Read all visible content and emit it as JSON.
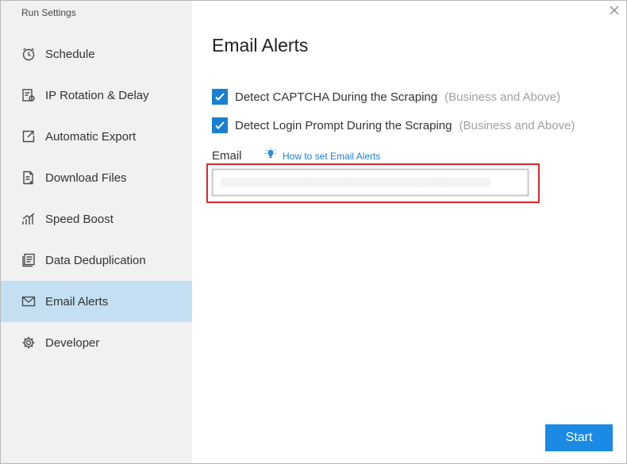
{
  "window": {
    "title": "Run Settings"
  },
  "sidebar": {
    "items": [
      {
        "label": "Schedule",
        "icon": "clock-icon",
        "active": false
      },
      {
        "label": "IP Rotation & Delay",
        "icon": "ip-rotation-icon",
        "active": false
      },
      {
        "label": "Automatic Export",
        "icon": "export-icon",
        "active": false
      },
      {
        "label": "Download Files",
        "icon": "file-download-icon",
        "active": false
      },
      {
        "label": "Speed Boost",
        "icon": "speed-boost-icon",
        "active": false
      },
      {
        "label": "Data Deduplication",
        "icon": "deduplication-icon",
        "active": false
      },
      {
        "label": "Email Alerts",
        "icon": "envelope-icon",
        "active": true
      },
      {
        "label": "Developer",
        "icon": "gear-icon",
        "active": false
      }
    ]
  },
  "main": {
    "title": "Email Alerts",
    "options": [
      {
        "label": "Detect CAPTCHA During the Scraping",
        "tier": "(Business and Above)",
        "checked": true
      },
      {
        "label": "Detect Login Prompt During the Scraping",
        "tier": "(Business and Above)",
        "checked": true
      }
    ],
    "email": {
      "label": "Email",
      "help_link": "How to set Email Alerts",
      "value": "░░░░░░░░░░░░░░░░░░░░░░░░░░░░░░░░░░░░░░░░░░"
    },
    "start_label": "Start"
  },
  "colors": {
    "accent": "#1a8ae5",
    "checkbox": "#1b7fd0",
    "sidebar_active": "#c3dff1",
    "highlight_border": "#e0262b"
  }
}
